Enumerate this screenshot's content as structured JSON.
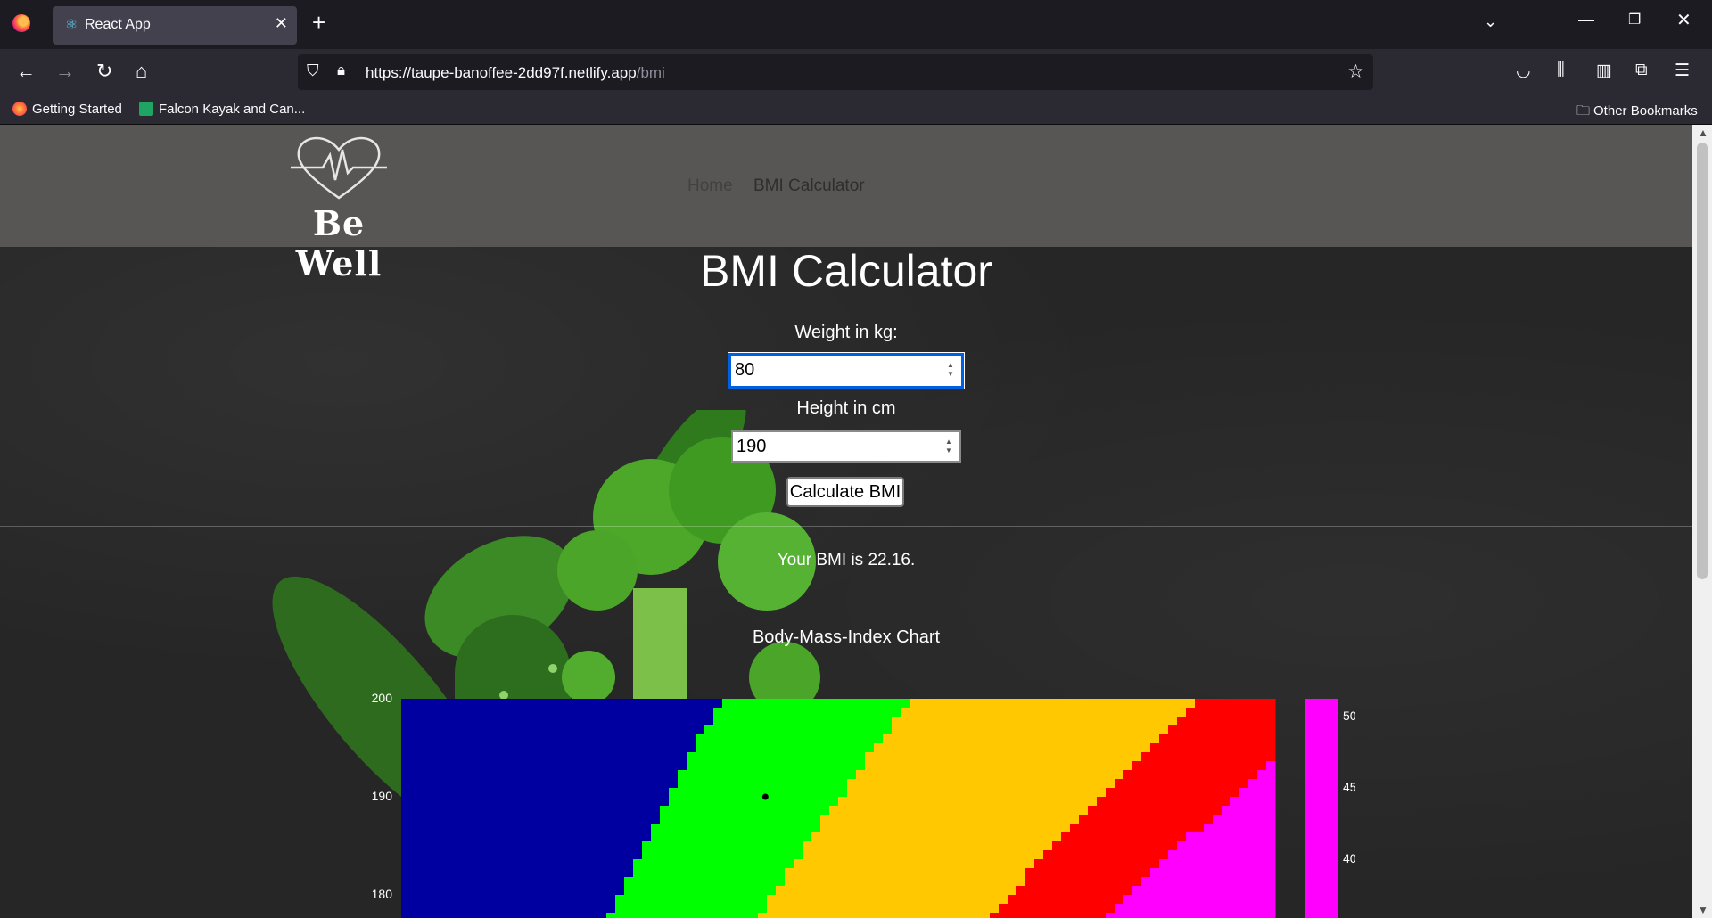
{
  "browser": {
    "tab_title": "React App",
    "url_host": "https://taupe-banoffee-2dd97f.netlify.app",
    "url_path": "/bmi",
    "bookmarks": [
      "Getting Started",
      "Falcon Kayak and Can..."
    ],
    "other_bookmarks": "Other Bookmarks"
  },
  "site": {
    "logo_text": "Be Well",
    "nav": [
      {
        "label": "Home"
      },
      {
        "label": "BMI Calculator"
      }
    ]
  },
  "calculator": {
    "title": "BMI Calculator",
    "weight_label": "Weight in kg:",
    "weight_value": "80",
    "height_label": "Height in cm",
    "height_value": "190",
    "button_label": "Calculate BMI",
    "result_text": "Your BMI is 22.16."
  },
  "chart_data": {
    "type": "heatmap",
    "title": "Body-Mass-Index Chart",
    "y_ticks": [
      "200",
      "190",
      "180"
    ],
    "colorbar_ticks": [
      "50",
      "45",
      "40"
    ],
    "colors": {
      "underweight": "#0000a0",
      "normal": "#00ff00",
      "overweight": "#ffc800",
      "obese": "#ff0000",
      "extreme": "#ff00ff"
    },
    "marker": {
      "weight": 80,
      "height": 190
    }
  }
}
